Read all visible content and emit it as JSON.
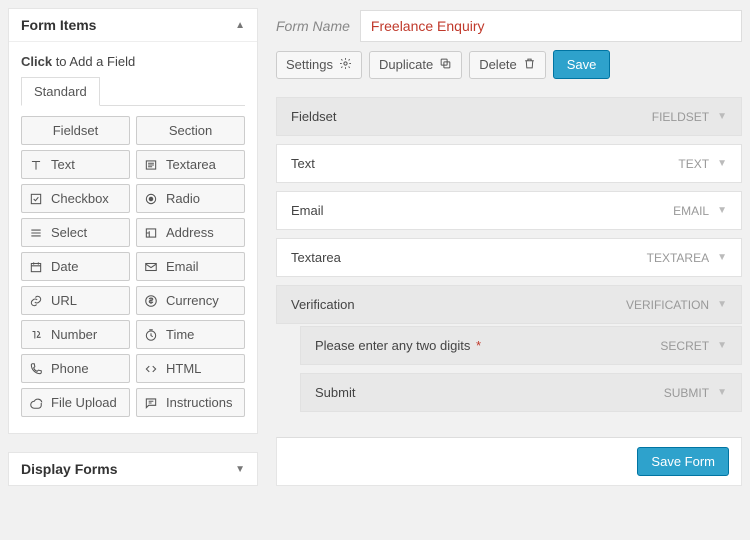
{
  "sidebar": {
    "form_items_title": "Form Items",
    "click_label_bold": "Click",
    "click_label_rest": " to Add a Field",
    "tab_standard": "Standard",
    "items": [
      "Fieldset",
      "Section",
      "Text",
      "Textarea",
      "Checkbox",
      "Radio",
      "Select",
      "Address",
      "Date",
      "Email",
      "URL",
      "Currency",
      "Number",
      "Time",
      "Phone",
      "HTML",
      "File Upload",
      "Instructions"
    ],
    "display_forms_title": "Display Forms"
  },
  "form": {
    "name_label": "Form Name",
    "name_value": "Freelance Enquiry",
    "name_placeholder": "",
    "toolbar": {
      "settings": "Settings",
      "duplicate": "Duplicate",
      "delete": "Delete",
      "save": "Save"
    },
    "save_form": "Save Form"
  },
  "rows": [
    {
      "name": "Fieldset",
      "type": "FIELDSET",
      "shaded": true,
      "required": false
    },
    {
      "name": "Text",
      "type": "TEXT",
      "shaded": false,
      "required": false
    },
    {
      "name": "Email",
      "type": "EMAIL",
      "shaded": false,
      "required": false
    },
    {
      "name": "Textarea",
      "type": "TEXTAREA",
      "shaded": false,
      "required": false
    },
    {
      "name": "Verification",
      "type": "VERIFICATION",
      "shaded": true,
      "required": false
    }
  ],
  "nested": [
    {
      "name": "Please enter any two digits",
      "type": "SECRET",
      "shaded": true,
      "required": true
    },
    {
      "name": "Submit",
      "type": "SUBMIT",
      "shaded": true,
      "required": false
    }
  ]
}
